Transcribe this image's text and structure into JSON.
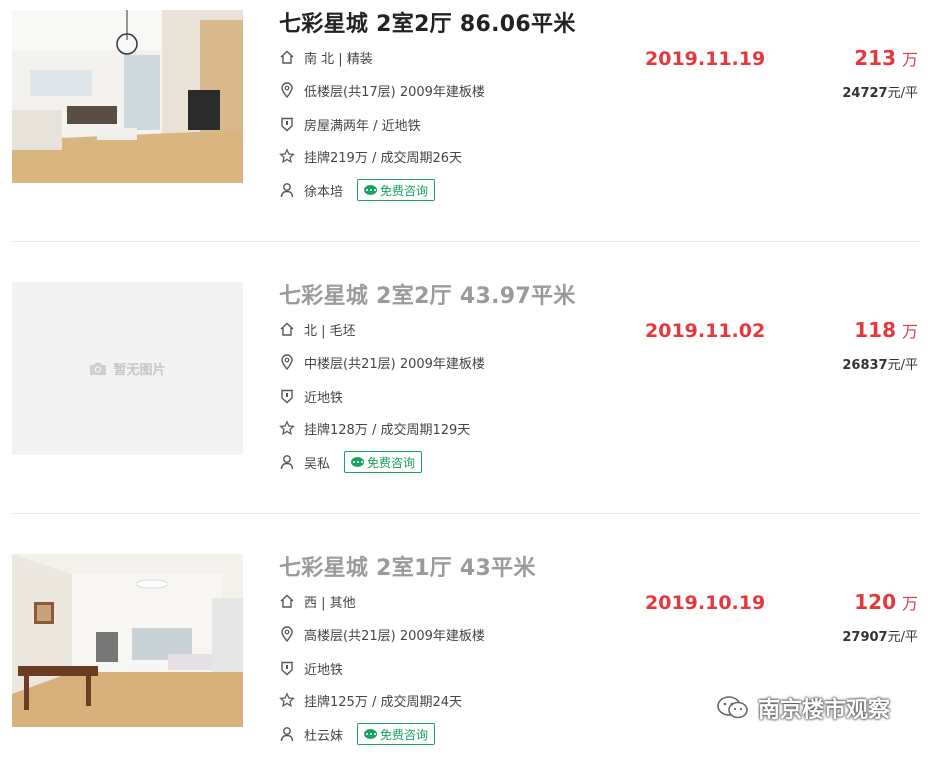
{
  "listings": [
    {
      "title": "七彩星城 2室2厅 86.06平米",
      "orientation": "南 北 | 精装",
      "floor": "低楼层(共17层) 2009年建板楼",
      "tags": "房屋满两年 / 近地铁",
      "listing_info": "挂牌219万 / 成交周期26天",
      "agent": "徐本培",
      "consult_label": "免费咨询",
      "deal_date": "2019.11.19",
      "total_price": "213",
      "total_unit": "万",
      "unit_price": "24727",
      "unit_price_suffix": "元/平",
      "has_image": true
    },
    {
      "title": "七彩星城 2室2厅 43.97平米",
      "orientation": "北 | 毛坯",
      "floor": "中楼层(共21层) 2009年建板楼",
      "tags": "近地铁",
      "listing_info": "挂牌128万 / 成交周期129天",
      "agent": "吴私",
      "consult_label": "免费咨询",
      "deal_date": "2019.11.02",
      "total_price": "118",
      "total_unit": "万",
      "unit_price": "26837",
      "unit_price_suffix": "元/平",
      "has_image": false,
      "no_image_text": "暂无图片"
    },
    {
      "title": "七彩星城 2室1厅 43平米",
      "orientation": "西 | 其他",
      "floor": "高楼层(共21层) 2009年建板楼",
      "tags": "近地铁",
      "listing_info": "挂牌125万 / 成交周期24天",
      "agent": "杜云妹",
      "consult_label": "免费咨询",
      "deal_date": "2019.10.19",
      "total_price": "120",
      "total_unit": "万",
      "unit_price": "27907",
      "unit_price_suffix": "元/平",
      "has_image": true
    }
  ],
  "watermark": "南京楼市观察",
  "icons": [
    "house-icon",
    "location-pin-icon",
    "shield-icon",
    "star-icon",
    "person-icon",
    "wechat-bubble-icon",
    "camera-icon"
  ],
  "colors": {
    "accent_red": "#e4393c",
    "consult_green": "#1aa260",
    "visited_title": "#9a9a9a"
  }
}
